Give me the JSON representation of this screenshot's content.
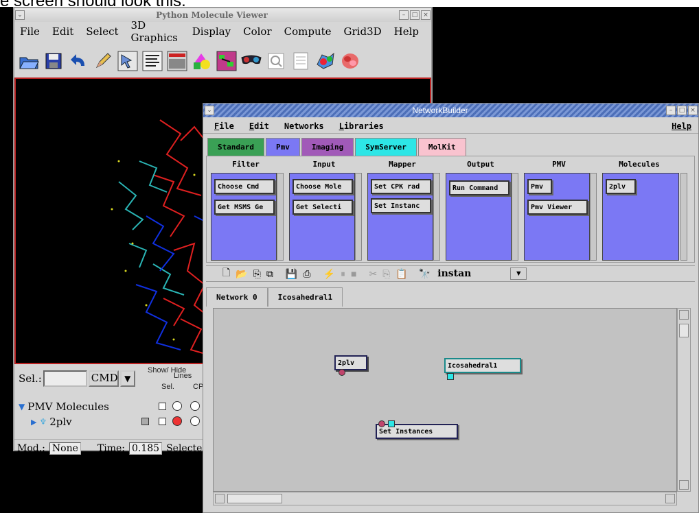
{
  "caption": "e screen should look this:",
  "pmv": {
    "title": "Python Molecule Viewer",
    "menu": [
      "File",
      "Edit",
      "Select",
      "3D Graphics",
      "Display",
      "Color",
      "Compute",
      "Grid3D",
      "Help"
    ],
    "toolbar_icons": [
      "open-folder-icon",
      "save-disk-icon",
      "undo-arrow-icon",
      "pencil-icon",
      "select-pointer-icon",
      "text-lines-icon",
      "console-icon",
      "color-shapes-icon",
      "graph-icon",
      "glasses-icon",
      "search-icon",
      "document-icon",
      "molecule-icon",
      "protein-icon"
    ],
    "sel_label": "Sel.:",
    "cmd_value": "CMD",
    "col_showhide": "Show/\nHide",
    "col_sel": "Sel.",
    "col_lines": "Lines",
    "col_cp": "CP",
    "tree_root": "PMV Molecules",
    "tree_child": "2plv",
    "mod_label": "Mod.:",
    "mod_value": "None",
    "time_label": "Time:",
    "time_value": "0.185",
    "selected_label": "Selected"
  },
  "nb": {
    "title": "NetworkBuilder",
    "menu": [
      "File",
      "Edit",
      "Networks",
      "Libraries"
    ],
    "help": "Help",
    "lib_tabs": [
      {
        "label": "Standard",
        "color": "#3aa055"
      },
      {
        "label": "Pmv",
        "color": "#7b78f4"
      },
      {
        "label": "Imaging",
        "color": "#a15ab8"
      },
      {
        "label": "SymServer",
        "color": "#2de6e6"
      },
      {
        "label": "MolKit",
        "color": "#f9c3cf"
      }
    ],
    "categories": [
      {
        "name": "Filter",
        "nodes": [
          "Choose Cmd",
          "Get MSMS Ge"
        ]
      },
      {
        "name": "Input",
        "nodes": [
          "Choose Mole",
          "Get Selecti"
        ]
      },
      {
        "name": "Mapper",
        "nodes": [
          "Set CPK rad",
          "Set Instanc"
        ]
      },
      {
        "name": "Output",
        "nodes": [
          "Run Command"
        ]
      },
      {
        "name": "PMV",
        "nodes": [
          "Pmv",
          "Pmv Viewer"
        ]
      },
      {
        "name": "Molecules",
        "nodes": [
          "2plv"
        ]
      }
    ],
    "search_value": "instan",
    "net_tabs": [
      "Network 0",
      "Icosahedral1"
    ],
    "canvas_nodes": [
      "2plv",
      "Icosahedral1",
      "Set Instances"
    ]
  }
}
